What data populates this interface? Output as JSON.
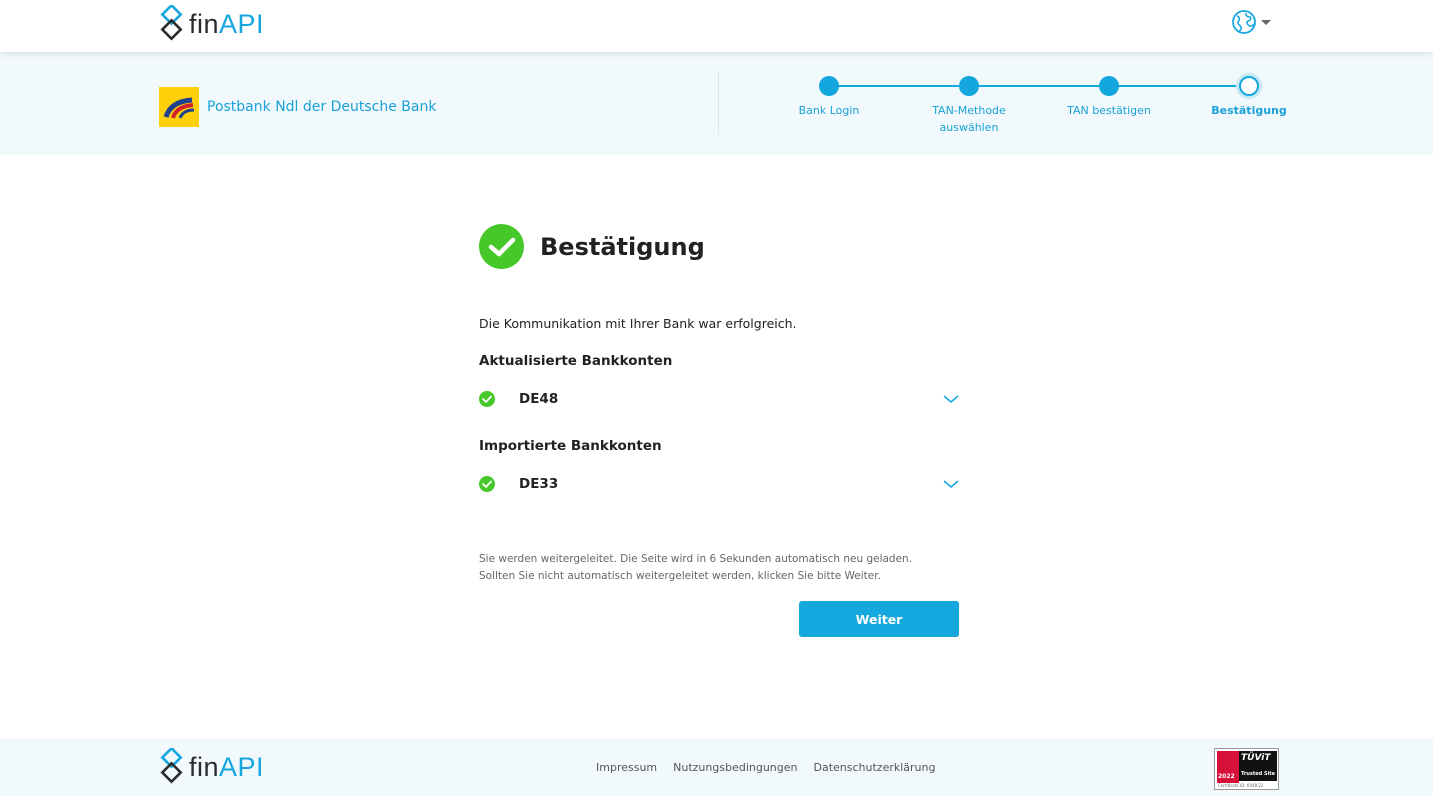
{
  "header": {
    "logo": {
      "fin": "fin",
      "api": "API"
    },
    "language_icon": "globe-icon"
  },
  "bank": {
    "name": "Postbank Ndl der Deutsche Bank",
    "logo_color": "#fdd00a"
  },
  "steps": [
    {
      "label": "Bank Login",
      "state": "done"
    },
    {
      "label": "TAN-Methode auswählen",
      "state": "done"
    },
    {
      "label": "TAN bestätigen",
      "state": "done"
    },
    {
      "label": "Bestätigung",
      "state": "current"
    }
  ],
  "main": {
    "title": "Bestätigung",
    "success_text": "Die Kommunikation mit Ihrer Bank war erfolgreich.",
    "updated_heading": "Aktualisierte Bankkonten",
    "updated_accounts": [
      "DE48"
    ],
    "imported_heading": "Importierte Bankkonten",
    "imported_accounts": [
      "DE33"
    ],
    "redirect_notice": "Sie werden weitergeleitet. Die Seite wird in 6 Sekunden automatisch neu geladen. Sollten Sie nicht automatisch weitergeleitet werden, klicken Sie bitte Weiter.",
    "continue_label": "Weiter"
  },
  "footer": {
    "links": [
      "Impressum",
      "Nutzungsbedingungen",
      "Datenschutzerklärung"
    ],
    "badge": {
      "brand": "TÜViT",
      "year": "2022",
      "caption": "Trusted Site",
      "cert": "Certificate ID: 6048.22"
    }
  },
  "colors": {
    "accent": "#15a8de",
    "success": "#46c82a",
    "band": "#f2f9fd"
  }
}
